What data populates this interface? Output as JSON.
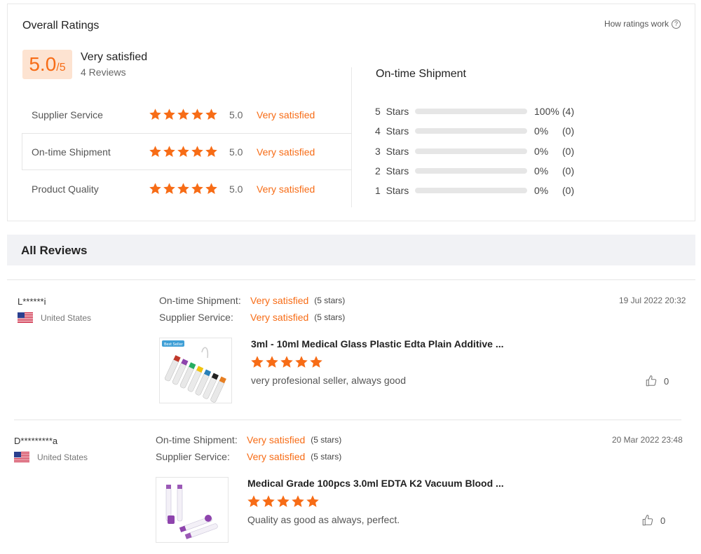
{
  "overall": {
    "title": "Overall Ratings",
    "how_link": "How ratings work",
    "help_glyph": "?",
    "score": "5.0",
    "score_max": "/5",
    "summary": "Very satisfied",
    "review_count": "4 Reviews",
    "categories": [
      {
        "label": "Supplier Service",
        "score": "5.0",
        "text": "Very satisfied",
        "stars": 5
      },
      {
        "label": "On-time Shipment",
        "score": "5.0",
        "text": "Very satisfied",
        "stars": 5
      },
      {
        "label": "Product Quality",
        "score": "5.0",
        "text": "Very satisfied",
        "stars": 5
      }
    ],
    "accent_color": "#f76c16"
  },
  "shipment": {
    "title": "On-time Shipment",
    "rows": [
      {
        "label": "5  Stars",
        "percent": "100%",
        "count": "(4)",
        "fill": 1.0
      },
      {
        "label": "4  Stars",
        "percent": "0%",
        "count": "(0)",
        "fill": 0
      },
      {
        "label": "3  Stars",
        "percent": "0%",
        "count": "(0)",
        "fill": 0
      },
      {
        "label": "2  Stars",
        "percent": "0%",
        "count": "(0)",
        "fill": 0
      },
      {
        "label": "1  Stars",
        "percent": "0%",
        "count": "(0)",
        "fill": 0
      }
    ]
  },
  "all_reviews": {
    "title": "All Reviews",
    "items": [
      {
        "name": "L******i",
        "country": "United States",
        "flag_icon": "us-flag-icon",
        "shipment_key": "On-time Shipment:",
        "shipment_value": "Very satisfied",
        "shipment_stars": "(5 stars)",
        "service_key": "Supplier Service:",
        "service_value": "Very satisfied",
        "service_stars": "(5 stars)",
        "date": "19 Jul 2022 20:32",
        "thumb_badge": "Best Seller",
        "product_title": "3ml - 10ml Medical Glass Plastic Edta Plain Additive ...",
        "rating": 5,
        "text": "very profesional seller, always good",
        "likes": "0"
      },
      {
        "name": "D*********a",
        "country": "United States",
        "flag_icon": "us-flag-icon",
        "shipment_key": "On-time Shipment:",
        "shipment_value": "Very satisfied",
        "shipment_stars": "(5 stars)",
        "service_key": "Supplier Service:",
        "service_value": "Very satisfied",
        "service_stars": "(5 stars)",
        "date": "20 Mar 2022 23:48",
        "product_title": "Medical Grade 100pcs 3.0ml EDTA K2 Vacuum Blood ...",
        "rating": 5,
        "text": "Quality as good as always, perfect.",
        "likes": "0"
      }
    ]
  }
}
